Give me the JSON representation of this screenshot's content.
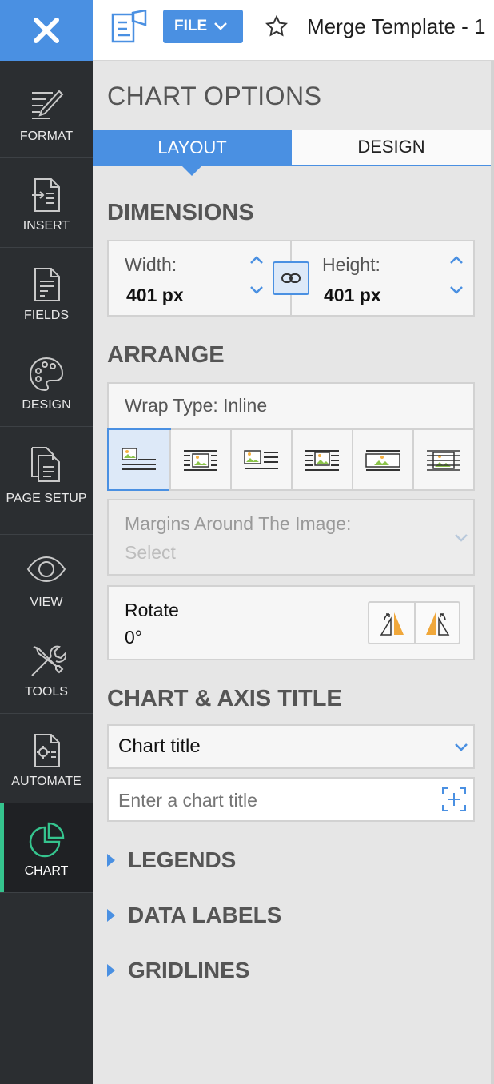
{
  "rail": {
    "items": [
      {
        "label": "FORMAT",
        "icon": "pen-ruler-icon"
      },
      {
        "label": "INSERT",
        "icon": "insert-doc-icon"
      },
      {
        "label": "FIELDS",
        "icon": "fields-doc-icon"
      },
      {
        "label": "DESIGN",
        "icon": "palette-icon"
      },
      {
        "label": "PAGE SETUP",
        "icon": "page-setup-icon"
      },
      {
        "label": "VIEW",
        "icon": "eye-icon"
      },
      {
        "label": "TOOLS",
        "icon": "tools-icon"
      },
      {
        "label": "AUTOMATE",
        "icon": "automate-icon"
      },
      {
        "label": "CHART",
        "icon": "pie-chart-icon"
      }
    ],
    "active": "CHART"
  },
  "topbar": {
    "file_label": "FILE",
    "document_title": "Merge Template - 1"
  },
  "panel": {
    "title": "CHART OPTIONS",
    "tabs": [
      {
        "label": "LAYOUT"
      },
      {
        "label": "DESIGN"
      }
    ],
    "active_tab": "LAYOUT",
    "dimensions": {
      "heading": "DIMENSIONS",
      "width_label": "Width:",
      "width_value": "401 px",
      "height_label": "Height:",
      "height_value": "401 px"
    },
    "arrange": {
      "heading": "ARRANGE",
      "wrap_type": "Wrap Type: Inline",
      "margins_label": "Margins Around The Image:",
      "margins_value": "Select",
      "rotate_label": "Rotate",
      "rotate_value": "0°"
    },
    "chart_axis_title": {
      "heading": "CHART & AXIS TITLE",
      "select_value": "Chart title",
      "input_placeholder": "Enter a chart title"
    },
    "collapsibles": [
      "LEGENDS",
      "DATA LABELS",
      "GRIDLINES"
    ]
  },
  "colors": {
    "accent": "#4a90e2",
    "rail_bg": "#2b2e31",
    "active_indicator": "#35c48e",
    "panel_bg": "#e6e6e6"
  }
}
